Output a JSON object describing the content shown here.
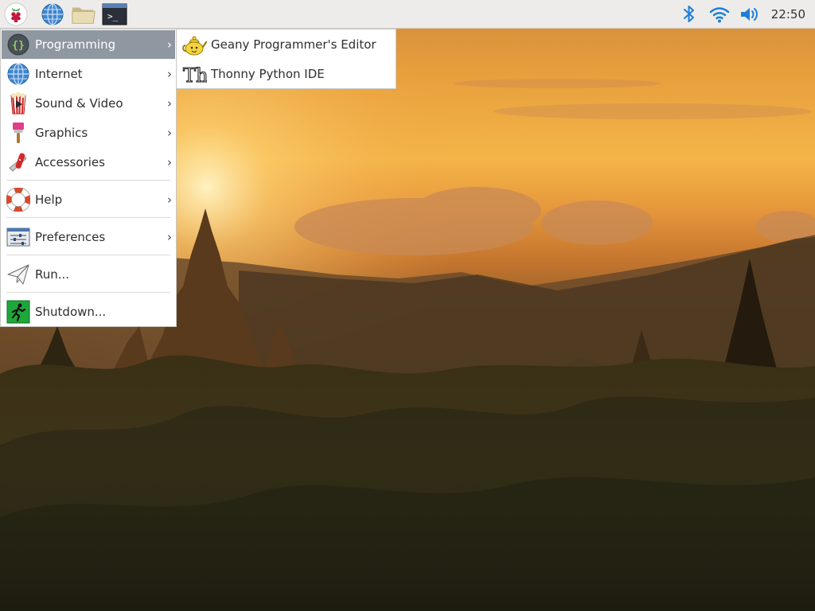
{
  "taskbar": {
    "launchers": [
      {
        "name": "raspberry-menu-button",
        "icon": "raspberry-icon"
      },
      {
        "name": "web-browser-launcher",
        "icon": "globe-icon"
      },
      {
        "name": "file-manager-launcher",
        "icon": "folder-icon"
      },
      {
        "name": "terminal-launcher",
        "icon": "terminal-icon",
        "glyph": ">_"
      }
    ],
    "tray": {
      "bluetooth_icon": "bluetooth-icon",
      "wifi_icon": "wifi-icon",
      "volume_icon": "volume-icon",
      "clock": "22:50"
    }
  },
  "main_menu": {
    "items": [
      {
        "label": "Programming",
        "icon": "code-braces-icon",
        "has_submenu": true,
        "active": true
      },
      {
        "label": "Internet",
        "icon": "globe-icon",
        "has_submenu": true
      },
      {
        "label": "Sound & Video",
        "icon": "popcorn-video-icon",
        "has_submenu": true
      },
      {
        "label": "Graphics",
        "icon": "paintbrush-icon",
        "has_submenu": true
      },
      {
        "label": "Accessories",
        "icon": "swiss-knife-icon",
        "has_submenu": true
      },
      {
        "label": "Help",
        "icon": "lifebuoy-icon",
        "has_submenu": true
      },
      {
        "label": "Preferences",
        "icon": "preferences-sliders-icon",
        "has_submenu": true
      },
      {
        "label": "Run...",
        "icon": "paper-plane-icon",
        "has_submenu": false
      },
      {
        "label": "Shutdown...",
        "icon": "exit-running-man-icon",
        "has_submenu": false
      }
    ],
    "submenu_arrow": "›"
  },
  "sub_menu": {
    "items": [
      {
        "label": "Geany Programmer's Editor",
        "icon": "geany-teapot-icon"
      },
      {
        "label": "Thonny Python IDE",
        "icon": "thonny-th-icon",
        "glyph": "Th"
      }
    ]
  },
  "colors": {
    "taskbar_bg": "#edecea",
    "menu_bg": "#ffffff",
    "menu_highlight": "#8f97a0",
    "bluetooth": "#1f7fd6",
    "wifi": "#1f7fd6"
  }
}
